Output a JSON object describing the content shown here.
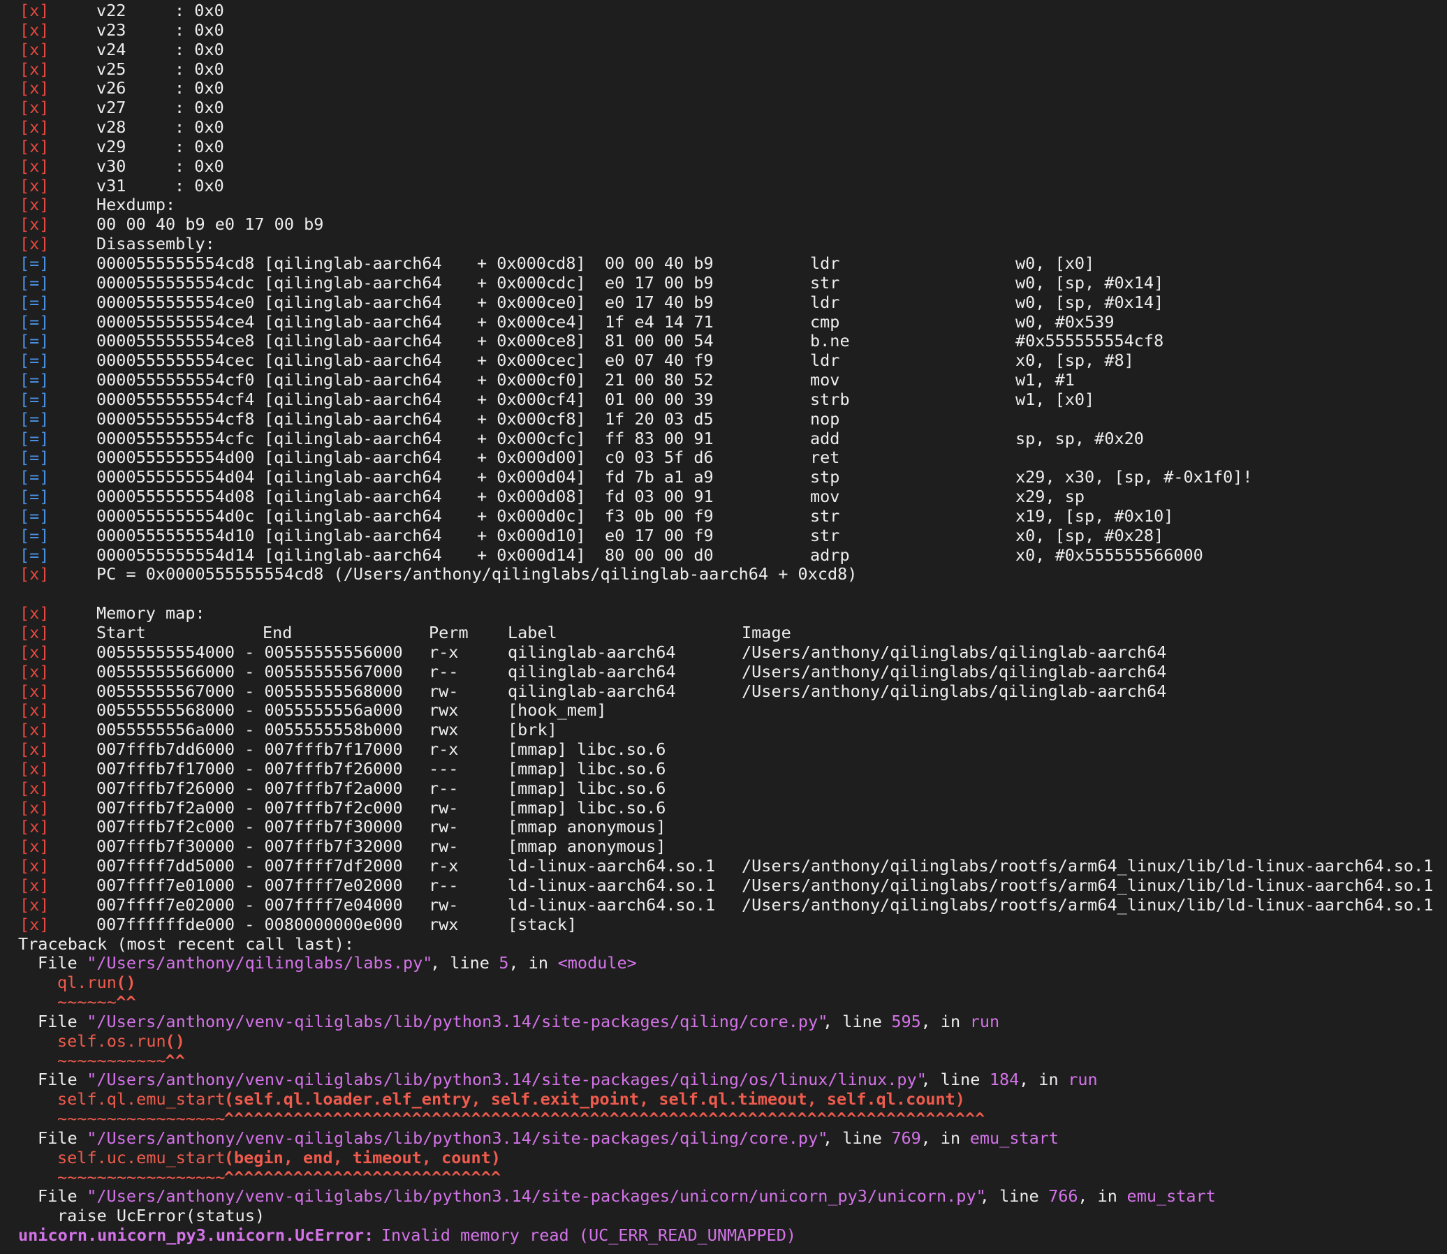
{
  "log_tags": {
    "error": "[x]",
    "info": "[=]"
  },
  "registers": [
    {
      "name": "v22",
      "value": ": 0x0"
    },
    {
      "name": "v23",
      "value": ": 0x0"
    },
    {
      "name": "v24",
      "value": ": 0x0"
    },
    {
      "name": "v25",
      "value": ": 0x0"
    },
    {
      "name": "v26",
      "value": ": 0x0"
    },
    {
      "name": "v27",
      "value": ": 0x0"
    },
    {
      "name": "v28",
      "value": ": 0x0"
    },
    {
      "name": "v29",
      "value": ": 0x0"
    },
    {
      "name": "v30",
      "value": ": 0x0"
    },
    {
      "name": "v31",
      "value": ": 0x0"
    }
  ],
  "hexdump": {
    "title": "Hexdump:",
    "bytes": "00 00 40 b9 e0 17 00 b9"
  },
  "disassembly": {
    "title": "Disassembly:",
    "rows": [
      {
        "addr": "0000555555554cd8",
        "module": "[qilinglab-aarch64",
        "offset": "+ 0x000cd8]",
        "bytes": "00 00 40 b9",
        "mnemonic": "ldr",
        "operands": "w0, [x0]"
      },
      {
        "addr": "0000555555554cdc",
        "module": "[qilinglab-aarch64",
        "offset": "+ 0x000cdc]",
        "bytes": "e0 17 00 b9",
        "mnemonic": "str",
        "operands": "w0, [sp, #0x14]"
      },
      {
        "addr": "0000555555554ce0",
        "module": "[qilinglab-aarch64",
        "offset": "+ 0x000ce0]",
        "bytes": "e0 17 40 b9",
        "mnemonic": "ldr",
        "operands": "w0, [sp, #0x14]"
      },
      {
        "addr": "0000555555554ce4",
        "module": "[qilinglab-aarch64",
        "offset": "+ 0x000ce4]",
        "bytes": "1f e4 14 71",
        "mnemonic": "cmp",
        "operands": "w0, #0x539"
      },
      {
        "addr": "0000555555554ce8",
        "module": "[qilinglab-aarch64",
        "offset": "+ 0x000ce8]",
        "bytes": "81 00 00 54",
        "mnemonic": "b.ne",
        "operands": "#0x555555554cf8"
      },
      {
        "addr": "0000555555554cec",
        "module": "[qilinglab-aarch64",
        "offset": "+ 0x000cec]",
        "bytes": "e0 07 40 f9",
        "mnemonic": "ldr",
        "operands": "x0, [sp, #8]"
      },
      {
        "addr": "0000555555554cf0",
        "module": "[qilinglab-aarch64",
        "offset": "+ 0x000cf0]",
        "bytes": "21 00 80 52",
        "mnemonic": "mov",
        "operands": "w1, #1"
      },
      {
        "addr": "0000555555554cf4",
        "module": "[qilinglab-aarch64",
        "offset": "+ 0x000cf4]",
        "bytes": "01 00 00 39",
        "mnemonic": "strb",
        "operands": "w1, [x0]"
      },
      {
        "addr": "0000555555554cf8",
        "module": "[qilinglab-aarch64",
        "offset": "+ 0x000cf8]",
        "bytes": "1f 20 03 d5",
        "mnemonic": "nop",
        "operands": ""
      },
      {
        "addr": "0000555555554cfc",
        "module": "[qilinglab-aarch64",
        "offset": "+ 0x000cfc]",
        "bytes": "ff 83 00 91",
        "mnemonic": "add",
        "operands": "sp, sp, #0x20"
      },
      {
        "addr": "0000555555554d00",
        "module": "[qilinglab-aarch64",
        "offset": "+ 0x000d00]",
        "bytes": "c0 03 5f d6",
        "mnemonic": "ret",
        "operands": ""
      },
      {
        "addr": "0000555555554d04",
        "module": "[qilinglab-aarch64",
        "offset": "+ 0x000d04]",
        "bytes": "fd 7b a1 a9",
        "mnemonic": "stp",
        "operands": "x29, x30, [sp, #-0x1f0]!"
      },
      {
        "addr": "0000555555554d08",
        "module": "[qilinglab-aarch64",
        "offset": "+ 0x000d08]",
        "bytes": "fd 03 00 91",
        "mnemonic": "mov",
        "operands": "x29, sp"
      },
      {
        "addr": "0000555555554d0c",
        "module": "[qilinglab-aarch64",
        "offset": "+ 0x000d0c]",
        "bytes": "f3 0b 00 f9",
        "mnemonic": "str",
        "operands": "x19, [sp, #0x10]"
      },
      {
        "addr": "0000555555554d10",
        "module": "[qilinglab-aarch64",
        "offset": "+ 0x000d10]",
        "bytes": "e0 17 00 f9",
        "mnemonic": "str",
        "operands": "x0, [sp, #0x28]"
      },
      {
        "addr": "0000555555554d14",
        "module": "[qilinglab-aarch64",
        "offset": "+ 0x000d14]",
        "bytes": "80 00 00 d0",
        "mnemonic": "adrp",
        "operands": "x0, #0x555555566000"
      }
    ]
  },
  "pc_line": "PC = 0x0000555555554cd8 (/Users/anthony/qilinglabs/qilinglab-aarch64 + 0xcd8)",
  "memory_map": {
    "title": "Memory map:",
    "headers": {
      "start": "Start",
      "end": "End",
      "perm": "Perm",
      "label": "Label",
      "image": "Image"
    },
    "rows": [
      {
        "start": "00555555554000",
        "end": "00555555556000",
        "perm": "r-x",
        "label": "qilinglab-aarch64",
        "image": "/Users/anthony/qilinglabs/qilinglab-aarch64"
      },
      {
        "start": "00555555566000",
        "end": "00555555567000",
        "perm": "r--",
        "label": "qilinglab-aarch64",
        "image": "/Users/anthony/qilinglabs/qilinglab-aarch64"
      },
      {
        "start": "00555555567000",
        "end": "00555555568000",
        "perm": "rw-",
        "label": "qilinglab-aarch64",
        "image": "/Users/anthony/qilinglabs/qilinglab-aarch64"
      },
      {
        "start": "00555555568000",
        "end": "0055555556a000",
        "perm": "rwx",
        "label": "[hook_mem]",
        "image": ""
      },
      {
        "start": "0055555556a000",
        "end": "0055555558b000",
        "perm": "rwx",
        "label": "[brk]",
        "image": ""
      },
      {
        "start": "007fffb7dd6000",
        "end": "007fffb7f17000",
        "perm": "r-x",
        "label": "[mmap] libc.so.6",
        "image": ""
      },
      {
        "start": "007fffb7f17000",
        "end": "007fffb7f26000",
        "perm": "---",
        "label": "[mmap] libc.so.6",
        "image": ""
      },
      {
        "start": "007fffb7f26000",
        "end": "007fffb7f2a000",
        "perm": "r--",
        "label": "[mmap] libc.so.6",
        "image": ""
      },
      {
        "start": "007fffb7f2a000",
        "end": "007fffb7f2c000",
        "perm": "rw-",
        "label": "[mmap] libc.so.6",
        "image": ""
      },
      {
        "start": "007fffb7f2c000",
        "end": "007fffb7f30000",
        "perm": "rw-",
        "label": "[mmap anonymous]",
        "image": ""
      },
      {
        "start": "007fffb7f30000",
        "end": "007fffb7f32000",
        "perm": "rw-",
        "label": "[mmap anonymous]",
        "image": ""
      },
      {
        "start": "007ffff7dd5000",
        "end": "007ffff7df2000",
        "perm": "r-x",
        "label": "ld-linux-aarch64.so.1",
        "image": "/Users/anthony/qilinglabs/rootfs/arm64_linux/lib/ld-linux-aarch64.so.1"
      },
      {
        "start": "007ffff7e01000",
        "end": "007ffff7e02000",
        "perm": "r--",
        "label": "ld-linux-aarch64.so.1",
        "image": "/Users/anthony/qilinglabs/rootfs/arm64_linux/lib/ld-linux-aarch64.so.1"
      },
      {
        "start": "007ffff7e02000",
        "end": "007ffff7e04000",
        "perm": "rw-",
        "label": "ld-linux-aarch64.so.1",
        "image": "/Users/anthony/qilinglabs/rootfs/arm64_linux/lib/ld-linux-aarch64.so.1"
      },
      {
        "start": "007ffffffde000",
        "end": "0080000000e000",
        "perm": "rwx",
        "label": "[stack]",
        "image": ""
      }
    ]
  },
  "traceback": {
    "header": "Traceback (most recent call last):",
    "frames": [
      {
        "file": "\"/Users/anthony/qilinglabs/labs.py\"",
        "line": "5",
        "func": "<module>",
        "code_plain": "ql.run",
        "code_bold": "()",
        "marker_tilde": "~~~~~~",
        "marker_caret": "^^"
      },
      {
        "file": "\"/Users/anthony/venv-qiliglabs/lib/python3.14/site-packages/qiling/core.py\"",
        "line": "595",
        "func": "run",
        "code_plain": "self.os.run",
        "code_bold": "()",
        "marker_tilde": "~~~~~~~~~~~",
        "marker_caret": "^^"
      },
      {
        "file": "\"/Users/anthony/venv-qiliglabs/lib/python3.14/site-packages/qiling/os/linux/linux.py\"",
        "line": "184",
        "func": "run",
        "code_plain": "self.ql.emu_start",
        "code_bold": "(self.ql.loader.elf_entry, self.exit_point, self.ql.timeout, self.ql.count)",
        "marker_tilde": "~~~~~~~~~~~~~~~~~",
        "marker_caret": "^^^^^^^^^^^^^^^^^^^^^^^^^^^^^^^^^^^^^^^^^^^^^^^^^^^^^^^^^^^^^^^^^^^^^^^^^^^^^"
      },
      {
        "file": "\"/Users/anthony/venv-qiliglabs/lib/python3.14/site-packages/qiling/core.py\"",
        "line": "769",
        "func": "emu_start",
        "code_plain": "self.uc.emu_start",
        "code_bold": "(begin, end, timeout, count)",
        "marker_tilde": "~~~~~~~~~~~~~~~~~",
        "marker_caret": "^^^^^^^^^^^^^^^^^^^^^^^^^^^^"
      },
      {
        "file": "\"/Users/anthony/venv-qiliglabs/lib/python3.14/site-packages/unicorn/unicorn_py3/unicorn.py\"",
        "line": "766",
        "func": "emu_start",
        "code_plain": "raise UcError(status)",
        "code_bold": "",
        "marker_tilde": "",
        "marker_caret": ""
      }
    ],
    "exception_type": "unicorn.unicorn_py3.unicorn.UcError",
    "exception_message": "Invalid memory read (UC_ERR_READ_UNMAPPED)"
  },
  "colors": {
    "background": "#1e1e1e",
    "text": "#ededed",
    "error_tag": "#e5483f",
    "info_tag": "#4a90e2",
    "highlight_pink": "#d373e8",
    "highlight_red": "#ef5b4d"
  }
}
